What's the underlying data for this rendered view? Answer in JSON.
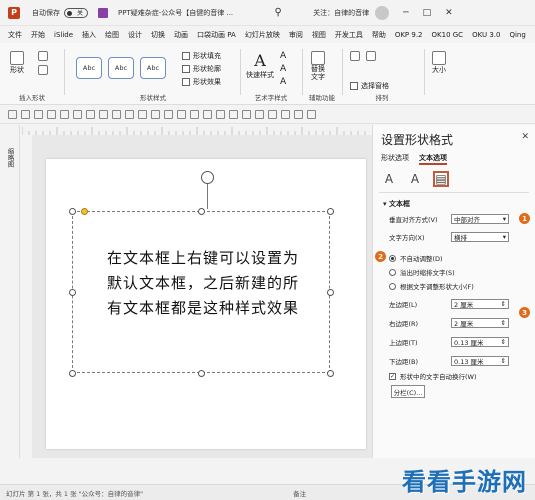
{
  "titlebar": {
    "autosave": "自动保存",
    "toggle": "关",
    "doc_title": "PPT疑难杂症-公众号【自健的音律 ...",
    "user": "关注：自律的音律",
    "min": "─",
    "restore": "□",
    "close": "✕"
  },
  "tabs": [
    "文件",
    "开始",
    "iSlide",
    "插入",
    "绘图",
    "设计",
    "切换",
    "动画",
    "口袋动画 PA",
    "幻灯片放映",
    "审阅",
    "视图",
    "开发工具",
    "帮助",
    "OKP 9.2",
    "OK10 GC",
    "OKU 3.0",
    "Qing"
  ],
  "ribbon": {
    "group_insert": "插入形状",
    "shape_label": "形状",
    "group_style": "形状样式",
    "abc": "Abc",
    "fill": "形状填充",
    "outline": "形状轮廓",
    "effect": "形状效果",
    "quickstyle": "快速样式",
    "group_art": "艺术字样式",
    "alt_text": "替换文字",
    "group_aux": "辅助功能",
    "select_pane": "选择窗格",
    "group_arrange": "排列",
    "size_label": "大小"
  },
  "panel": {
    "title": "设置形状格式",
    "close": "✕",
    "tab_shape": "形状选项",
    "tab_text": "文本选项",
    "section": "文本框",
    "valign_label": "垂直对齐方式(V)",
    "valign_value": "中部对齐",
    "dir_label": "文字方向(X)",
    "dir_value": "横排",
    "opt_noauto": "不自动调整(D)",
    "opt_shrink": "溢出时缩排文字(S)",
    "opt_resize": "根据文字调整形状大小(F)",
    "left_label": "左边距(L)",
    "left_value": "2 厘米",
    "right_label": "右边距(R)",
    "right_value": "2 厘米",
    "top_label": "上边距(T)",
    "top_value": "0.13 厘米",
    "bottom_label": "下边距(B)",
    "bottom_value": "0.13 厘米",
    "wrap_label": "形状中的文字自动换行(W)",
    "columns_btn": "分栏(C)..."
  },
  "badges": [
    "1",
    "2",
    "3"
  ],
  "slide": {
    "text": "在文本框上右键可以设置为默认文本框，之后新建的所有文本框都是这种样式效果"
  },
  "left": {
    "thumb_label": "缩略图"
  },
  "status": {
    "left": "幻灯片 第 1 张，共 1 张   \"公众号：自律的音律\"",
    "notes": "备注"
  },
  "watermark": "看看手游网",
  "colors": {
    "accent": "#b7472a",
    "badge": "#e26b1b"
  }
}
